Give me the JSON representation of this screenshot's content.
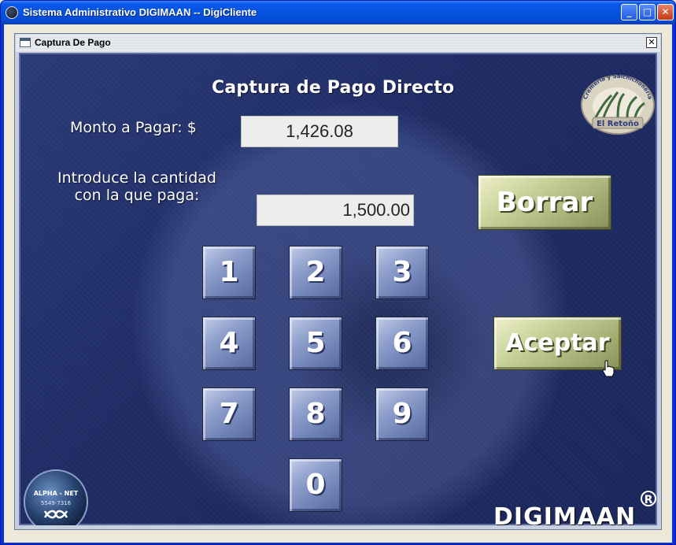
{
  "window": {
    "title": "Sistema Administrativo DIGIMAAN -- DigiCliente",
    "controls": {
      "minimize": "_",
      "maximize": "□",
      "close": "✕"
    }
  },
  "dialog": {
    "title": "Captura De Pago",
    "close_glyph": "✕"
  },
  "panel": {
    "heading": "Captura de Pago Directo",
    "monto_label": "Monto a Pagar: $",
    "monto_value": "1,426.08",
    "pago_label_line1": "Introduce la cantidad",
    "pago_label_line2": "con la que paga:",
    "pago_value": "1,500.00",
    "keys": [
      "1",
      "2",
      "3",
      "4",
      "5",
      "6",
      "7",
      "8",
      "9",
      "0"
    ],
    "borrar_label": "Borrar",
    "aceptar_label": "Aceptar",
    "brand_logo": {
      "arc_text": "Cremeria y Salchichoneria",
      "name": "El Retoño"
    },
    "alpha_logo": {
      "name": "ALPHA - NET",
      "phone": "5549-7316"
    },
    "brand_mark": {
      "text": "DIGIMAAN",
      "registered": "R"
    }
  },
  "colors": {
    "panel_bg": "#1e2b63",
    "key_face": "#8e9fcc",
    "action_face": "#c9d199",
    "titlebar": "#0453e0"
  }
}
